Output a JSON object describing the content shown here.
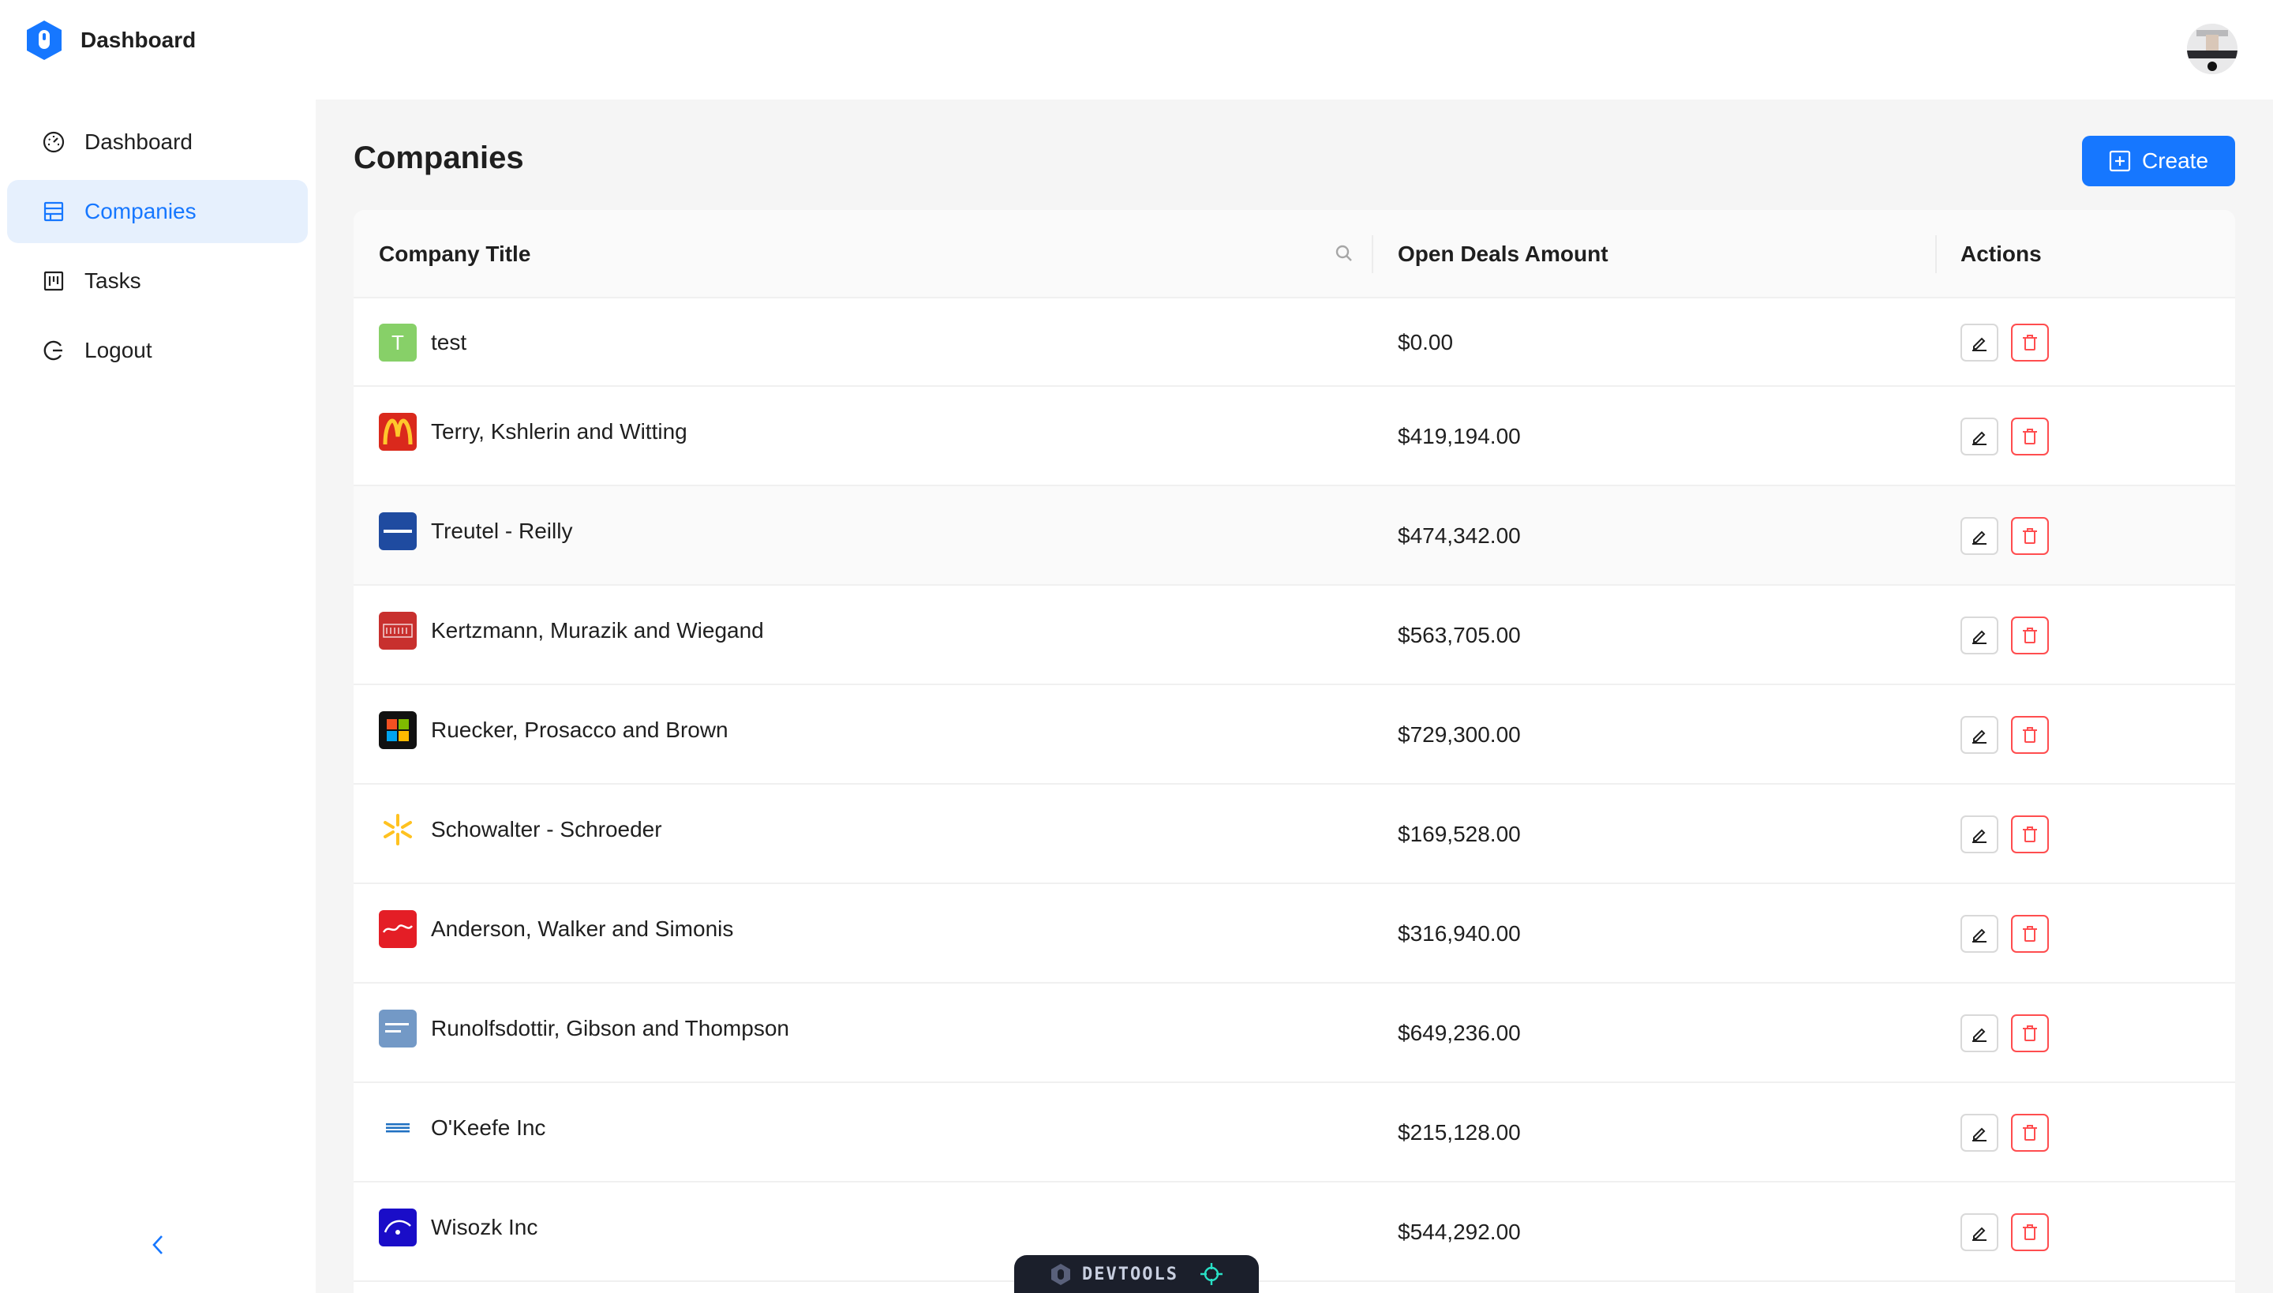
{
  "header": {
    "title": "Dashboard",
    "logo_icon": "refine-logo-icon",
    "avatar_icon": "user-avatar"
  },
  "sidebar": {
    "items": [
      {
        "label": "Dashboard",
        "icon": "dashboard-gauge-icon",
        "active": false
      },
      {
        "label": "Companies",
        "icon": "shop-icon",
        "active": true
      },
      {
        "label": "Tasks",
        "icon": "project-board-icon",
        "active": false
      },
      {
        "label": "Logout",
        "icon": "logout-icon",
        "active": false
      }
    ],
    "collapse_icon": "chevron-left-icon"
  },
  "main": {
    "page_title": "Companies",
    "create_label": "Create",
    "create_icon": "plus-square-icon"
  },
  "table": {
    "columns": [
      "Company Title",
      "Open Deals Amount",
      "Actions"
    ],
    "rows": [
      {
        "name": "test",
        "amount": "$0.00",
        "logo": "T",
        "logo_color": "#87d068"
      },
      {
        "name": "Terry, Kshlerin and Witting",
        "amount": "$419,194.00",
        "logo": "mcdonalds-logo",
        "logo_color": "#da291c"
      },
      {
        "name": "Treutel - Reilly",
        "amount": "$474,342.00",
        "logo": "pepsico-logo",
        "logo_color": "#1f4ba0"
      },
      {
        "name": "Kertzmann, Murazik and Wiegand",
        "amount": "$563,705.00",
        "logo": "cherry-logo",
        "logo_color": "#c8302e"
      },
      {
        "name": "Ruecker, Prosacco and Brown",
        "amount": "$729,300.00",
        "logo": "microsoft-logo",
        "logo_color": "#111111"
      },
      {
        "name": "Schowalter - Schroeder",
        "amount": "$169,528.00",
        "logo": "walmart-logo",
        "logo_color": "#ffc220"
      },
      {
        "name": "Anderson, Walker and Simonis",
        "amount": "$316,940.00",
        "logo": "coca-cola-logo",
        "logo_color": "#e41e26"
      },
      {
        "name": "Runolfsdottir, Gibson and Thompson",
        "amount": "$649,236.00",
        "logo": "goldman-sachs-logo",
        "logo_color": "#7399c6"
      },
      {
        "name": "O'Keefe Inc",
        "amount": "$215,128.00",
        "logo": "ibm-logo",
        "logo_color": "#1f70c1"
      },
      {
        "name": "Wisozk Inc",
        "amount": "$544,292.00",
        "logo": "disney-logo",
        "logo_color": "#1a0dc8"
      }
    ],
    "edit_icon": "edit-pencil-icon",
    "delete_icon": "trash-icon",
    "search_icon": "search-icon"
  },
  "devtools": {
    "label": "DEVTOOLS",
    "icon": "refine-logo-icon",
    "target_icon": "crosshair-icon"
  },
  "colors": {
    "primary": "#1677ff",
    "danger": "#ff4d4f",
    "active_bg": "#e6f0fd",
    "content_bg": "#f5f5f5"
  }
}
